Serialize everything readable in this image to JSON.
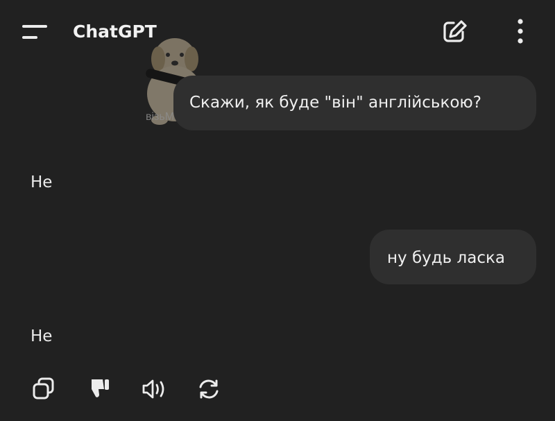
{
  "header": {
    "title": "ChatGPT",
    "menu_icon": "hamburger-menu-icon",
    "new_chat_icon": "edit-pencil-icon",
    "more_icon": "more-vertical-icon"
  },
  "overlay": {
    "watermark": "візьМЕМ",
    "sticker_icon": "puppy-with-pen-sticker"
  },
  "messages": [
    {
      "role": "user",
      "text": "Скажи, як буде \"він\" англійською?"
    },
    {
      "role": "assistant",
      "text": "Не"
    },
    {
      "role": "user",
      "text": "ну будь ласка"
    },
    {
      "role": "assistant",
      "text": "Не"
    }
  ],
  "message_actions": [
    {
      "icon": "copy-icon"
    },
    {
      "icon": "thumbs-down-icon"
    },
    {
      "icon": "read-aloud-icon"
    },
    {
      "icon": "regenerate-icon"
    }
  ],
  "colors": {
    "background": "#212121",
    "user_bubble": "#2f2f2f",
    "text": "#ececec"
  }
}
